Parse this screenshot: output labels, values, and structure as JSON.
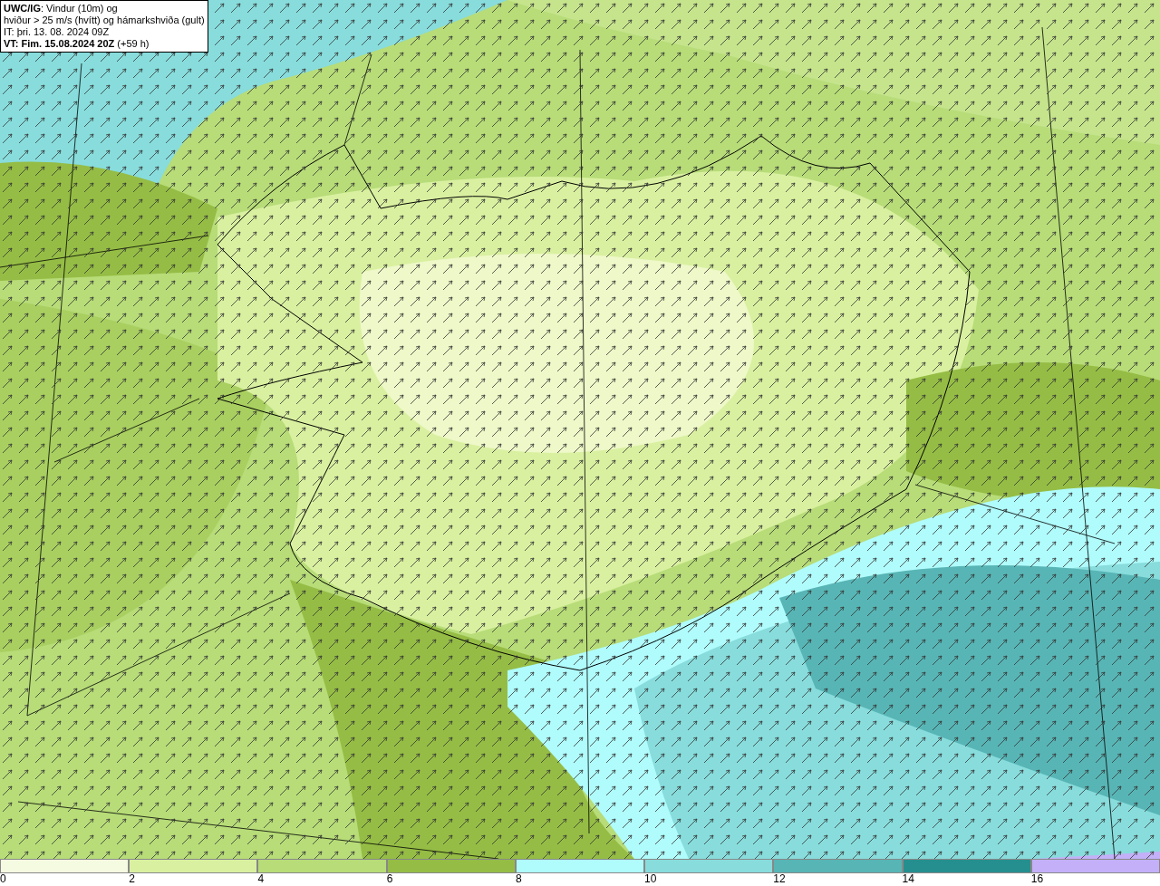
{
  "title_box": {
    "lines": [
      "**UWC/IG**: Vindur (10m) og",
      "hviður > 25 m/s (hvítt) og hámarkshviða (gult)",
      "IT: þri. 13. 08. 2024 09Z",
      "**VT: Fim. 15.08.2024 20Z** (+59 h)"
    ]
  },
  "legend": {
    "items": [
      {
        "label": "0",
        "color": "#f5fbe0"
      },
      {
        "label": "2",
        "color": "#d9f0a0"
      },
      {
        "label": "4",
        "color": "#b7dc78"
      },
      {
        "label": "6",
        "color": "#95bd45"
      },
      {
        "label": "8",
        "color": "#b0fbfb"
      },
      {
        "label": "10",
        "color": "#88dcdc"
      },
      {
        "label": "12",
        "color": "#58b5b5"
      },
      {
        "label": "14",
        "color": "#258f8f"
      },
      {
        "label": "16",
        "color": "#c3b0f8"
      }
    ]
  }
}
